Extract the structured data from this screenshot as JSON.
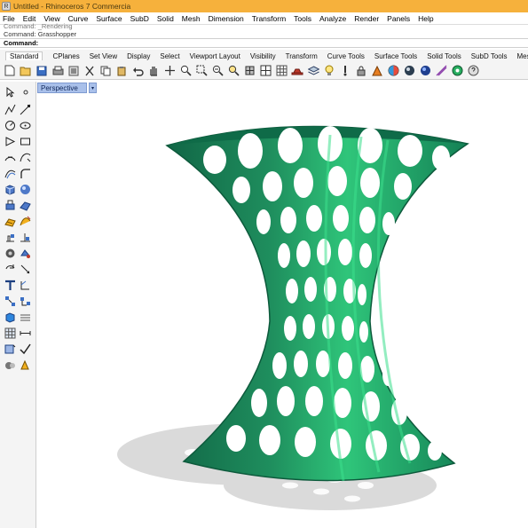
{
  "window": {
    "title": "Untitled - Rhinoceros 7 Commercia",
    "app_icon_glyph": "R"
  },
  "menu": [
    "File",
    "Edit",
    "View",
    "Curve",
    "Surface",
    "SubD",
    "Solid",
    "Mesh",
    "Dimension",
    "Transform",
    "Tools",
    "Analyze",
    "Render",
    "Panels",
    "Help"
  ],
  "command": {
    "history_line_1": "Command: _Rendering",
    "history_line_2": "Command: Grasshopper",
    "prompt_label": "Command:",
    "prompt_value": ""
  },
  "toolbar_tabs": [
    "Standard",
    "CPlanes",
    "Set View",
    "Display",
    "Select",
    "Viewport Layout",
    "Visibility",
    "Transform",
    "Curve Tools",
    "Surface Tools",
    "Solid Tools",
    "SubD Tools",
    "Mesh Tool"
  ],
  "toolbar_icons": [
    "new-icon",
    "open-icon",
    "save-icon",
    "print-icon",
    "import-icon",
    "cut-icon",
    "copy-icon",
    "paste-icon",
    "undo-icon",
    "pan-icon",
    "move-view-icon",
    "zoom-dynamic-icon",
    "zoom-window-icon",
    "zoom-extents-icon",
    "zoom-selected-icon",
    "rotate-view-icon",
    "four-view-icon",
    "grid-icon",
    "car-icon",
    "layer-icon",
    "light-icon",
    "properties-icon",
    "lock-icon",
    "material-icon",
    "render-icon",
    "shaded-icon",
    "rendered-icon",
    "wire-icon",
    "options-icon",
    "help-icon"
  ],
  "viewport": {
    "label": "Perspective",
    "menu_glyph": "▾"
  },
  "colors": {
    "titlebar": "#f6b13c",
    "viewport_tab": "#a9c0ea",
    "model_dark": "#1b7a55",
    "model_light": "#2ec67a",
    "shadow": "#d8d8d8"
  }
}
